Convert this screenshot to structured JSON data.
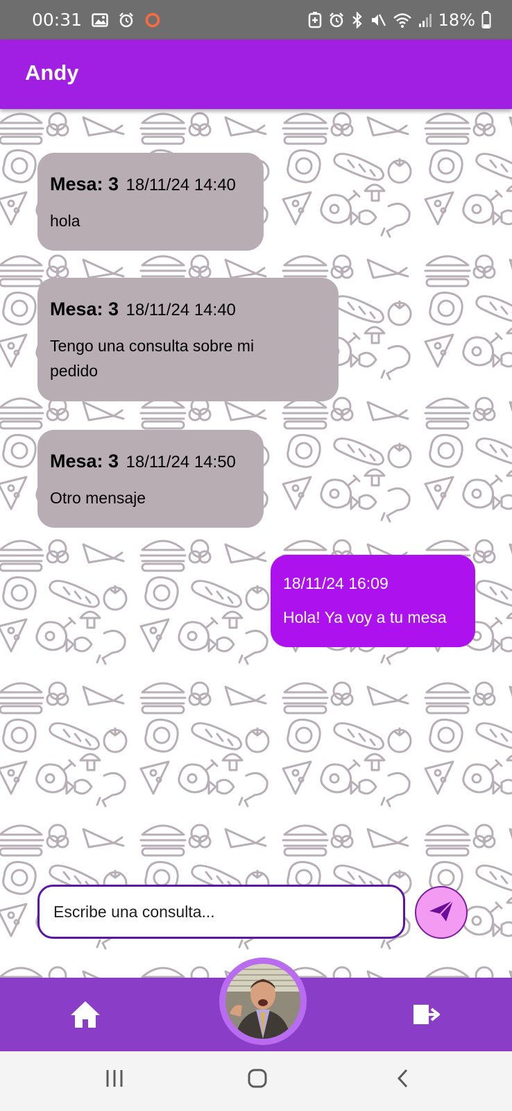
{
  "status_bar": {
    "time": "00:31",
    "battery": "18%"
  },
  "app_bar": {
    "title": "Andy"
  },
  "messages": [
    {
      "direction": "incoming",
      "mesa": "Mesa: 3",
      "timestamp": "18/11/24 14:40",
      "lines": [
        "hola"
      ]
    },
    {
      "direction": "incoming",
      "mesa": "Mesa: 3",
      "timestamp": "18/11/24 14:40",
      "lines": [
        "Tengo una consulta sobre mi",
        "pedido"
      ]
    },
    {
      "direction": "incoming",
      "mesa": "Mesa: 3",
      "timestamp": "18/11/24 14:50",
      "lines": [
        "Otro mensaje"
      ]
    },
    {
      "direction": "outgoing",
      "timestamp": "18/11/24 16:09",
      "lines": [
        "Hola! Ya voy a tu mesa"
      ]
    }
  ],
  "composer": {
    "placeholder": "Escribe una consulta..."
  },
  "bottom_nav": {
    "left_icon": "home-icon",
    "center": "profile-avatar",
    "right_icon": "logout-icon"
  },
  "system_nav": [
    "recent-apps-icon",
    "home-button-icon",
    "back-icon"
  ],
  "colors": {
    "app_bar": "#a11ee3",
    "incoming_bubble": "#b8adb3",
    "outgoing_bubble": "#ad12ee",
    "bottom_nav": "#8a3dc6",
    "send_button": "#f39af3",
    "input_border": "#5b15a8"
  }
}
